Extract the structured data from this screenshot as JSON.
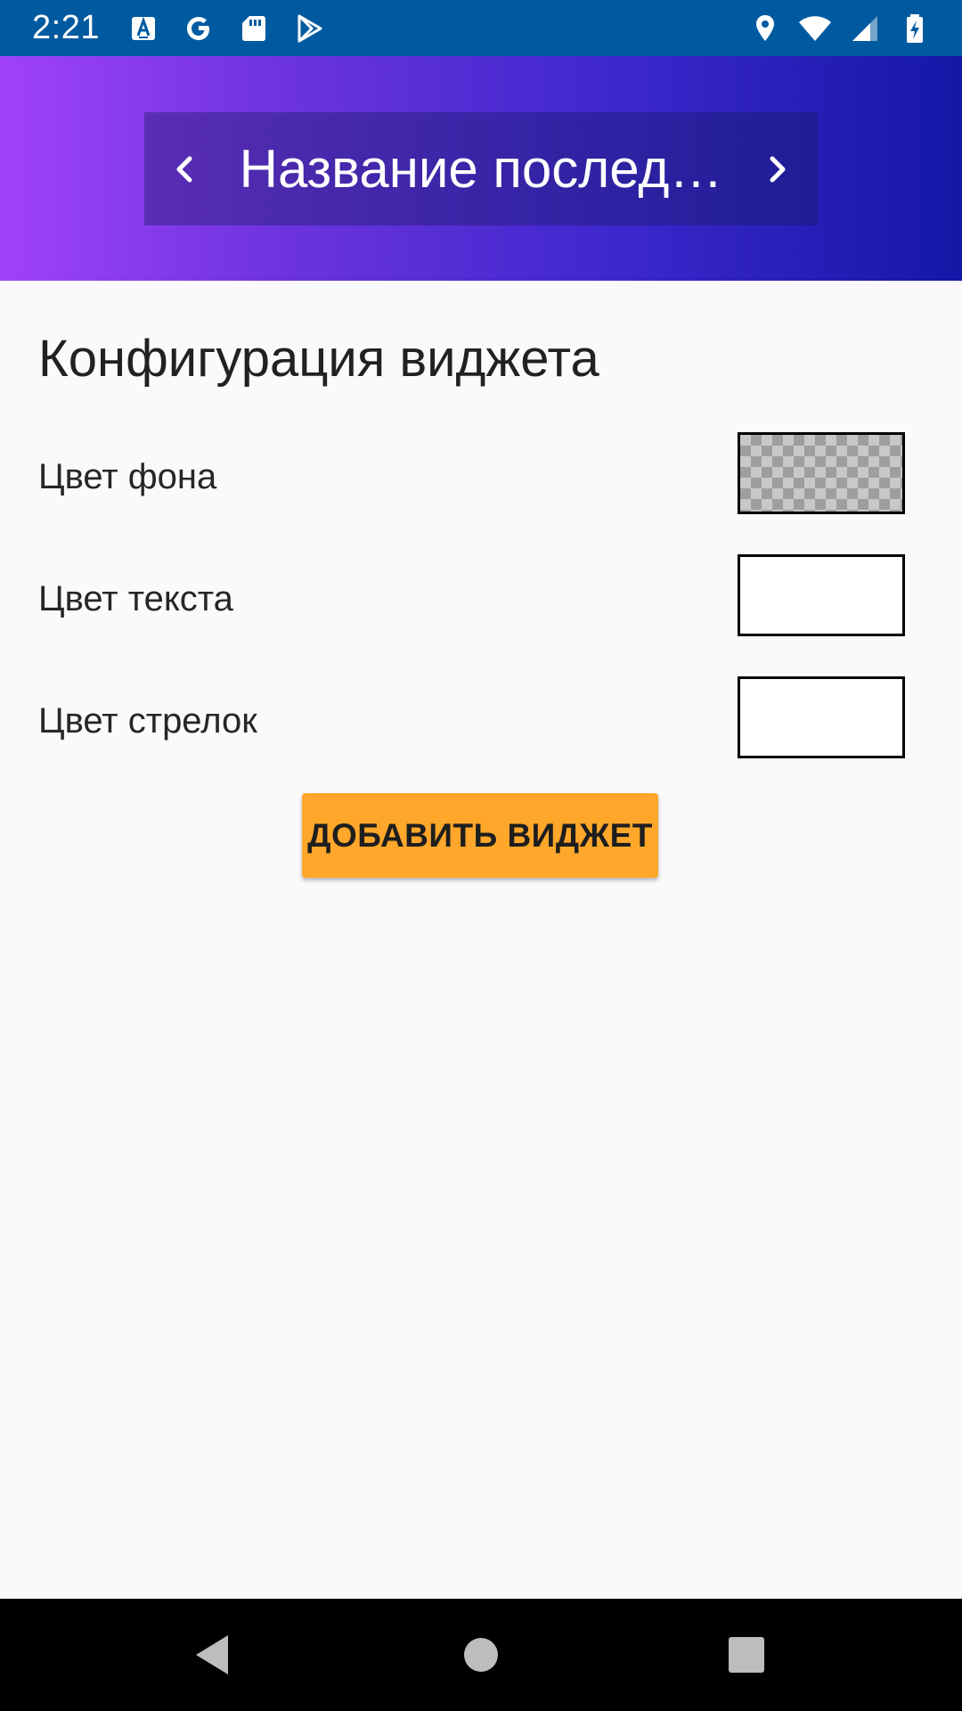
{
  "status_bar": {
    "time": "2:21",
    "left_icons": [
      "font-a-icon",
      "google-icon",
      "sd-card-icon",
      "play-store-icon"
    ],
    "right_icons": [
      "location-icon",
      "wifi-icon",
      "cell-signal-icon",
      "battery-charging-icon"
    ]
  },
  "widget_preview": {
    "title": "Название послед…",
    "prev_icon": "chevron-left-icon",
    "next_icon": "chevron-right-icon",
    "gradient_colors": [
      "#a042fb",
      "#1417a6"
    ]
  },
  "page": {
    "title": "Конфигурация виджета"
  },
  "settings": [
    {
      "label": "Цвет фона",
      "swatch": "transparent"
    },
    {
      "label": "Цвет текста",
      "swatch": "#ffffff"
    },
    {
      "label": "Цвет стрелок",
      "swatch": "#ffffff"
    }
  ],
  "add_button": {
    "label": "ДОБАВИТЬ ВИДЖЕТ",
    "color": "#ffa72a"
  },
  "nav_bar": {
    "buttons": [
      "back-icon",
      "home-icon",
      "recents-icon"
    ]
  }
}
